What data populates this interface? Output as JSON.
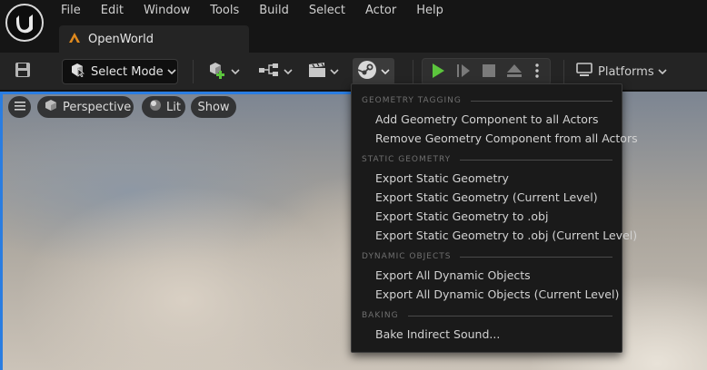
{
  "menubar": [
    "File",
    "Edit",
    "Window",
    "Tools",
    "Build",
    "Select",
    "Actor",
    "Help"
  ],
  "doc_tab": {
    "label": "OpenWorld",
    "icon": "level-icon",
    "icon_color": "#e08a1e"
  },
  "toolbar": {
    "select_mode_label": "Select Mode",
    "platforms_label": "Platforms",
    "play_color": "#5cc53d"
  },
  "viewport": {
    "perspective_label": "Perspective",
    "lit_label": "Lit",
    "show_label": "Show"
  },
  "dropdown": {
    "sections": [
      {
        "header": "GEOMETRY TAGGING",
        "items": [
          "Add Geometry Component to all Actors",
          "Remove Geometry Component from all Actors"
        ]
      },
      {
        "header": "STATIC GEOMETRY",
        "items": [
          "Export Static Geometry",
          "Export Static Geometry (Current Level)",
          "Export Static Geometry to .obj",
          "Export Static Geometry to .obj (Current Level)"
        ]
      },
      {
        "header": "DYNAMIC OBJECTS",
        "items": [
          "Export All Dynamic Objects",
          "Export All Dynamic Objects (Current Level)"
        ]
      },
      {
        "header": "BAKING",
        "items": [
          "Bake Indirect Sound..."
        ]
      }
    ]
  },
  "colors": {
    "accent": "#2a7de1",
    "menu_bg": "#1a1a1a",
    "toolbar_bg": "#242424"
  }
}
